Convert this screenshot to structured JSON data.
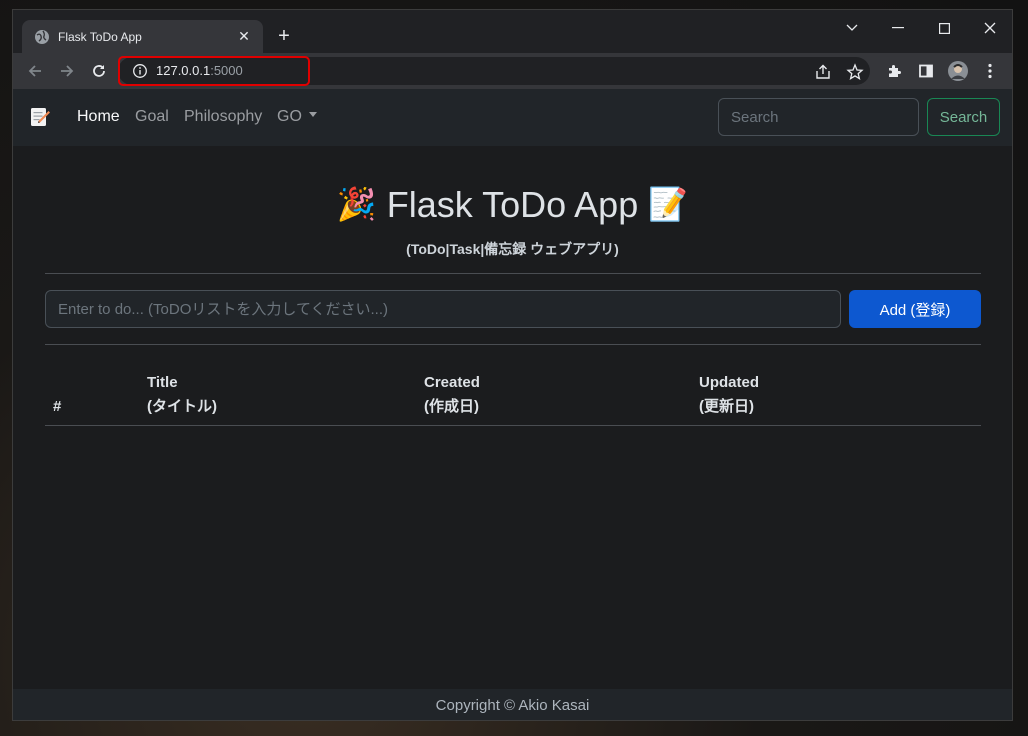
{
  "browser": {
    "tab_title": "Flask ToDo App",
    "tab_close": "✕",
    "new_tab": "+",
    "url_host": "127.0.0.1",
    "url_port": ":5000"
  },
  "navbar": {
    "links": [
      "Home",
      "Goal",
      "Philosophy",
      "GO"
    ],
    "search_placeholder": "Search",
    "search_button": "Search"
  },
  "hero": {
    "title_prefix_emoji": "🎉",
    "title": "Flask ToDo App",
    "title_suffix_emoji": "📝",
    "subtitle": "(ToDo|Task|備忘録 ウェブアプリ)"
  },
  "form": {
    "placeholder": "Enter to do... (ToDOリストを入力してください...)",
    "add_button": "Add (登録)"
  },
  "table": {
    "headers": [
      {
        "line1": "",
        "line2": "#"
      },
      {
        "line1": "Title",
        "line2": "(タイトル)"
      },
      {
        "line1": "Created",
        "line2": "(作成日)"
      },
      {
        "line1": "Updated",
        "line2": "(更新日)"
      }
    ]
  },
  "footer": {
    "text": "Copyright © Akio Kasai"
  },
  "colors": {
    "primary": "#0d58d0",
    "success": "#198754",
    "highlight": "#e00000"
  }
}
